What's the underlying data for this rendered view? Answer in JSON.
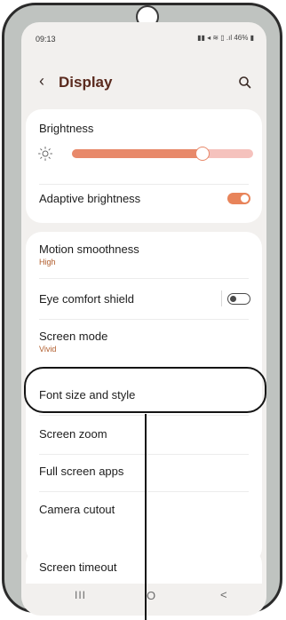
{
  "status_bar": {
    "time": "09:13",
    "icons_text": "▮▮ ✉ ⋒ ▮ .ıl 46%",
    "battery": "46%"
  },
  "header": {
    "title": "Display"
  },
  "brightness": {
    "label": "Brightness",
    "level": 0.74
  },
  "adaptive_brightness": {
    "label": "Adaptive brightness",
    "enabled": true
  },
  "motion_smoothness": {
    "label": "Motion smoothness",
    "value": "High"
  },
  "eye_comfort_shield": {
    "label": "Eye comfort shield",
    "enabled": false
  },
  "screen_mode": {
    "label": "Screen mode",
    "value": "Vivid"
  },
  "font_size_and_style": {
    "label": "Font size and style"
  },
  "screen_zoom": {
    "label": "Screen zoom"
  },
  "full_screen_apps": {
    "label": "Full screen apps"
  },
  "camera_cutout": {
    "label": "Camera cutout"
  },
  "screen_timeout": {
    "label": "Screen timeout"
  },
  "navbar": {
    "recents": "III",
    "home": "O",
    "back": "<"
  },
  "colors": {
    "accent": "#e88a5c",
    "title": "#5a2a1e",
    "subtext": "#b05c2b",
    "background": "#f2f0ee",
    "frame": "#bfc3c0"
  }
}
